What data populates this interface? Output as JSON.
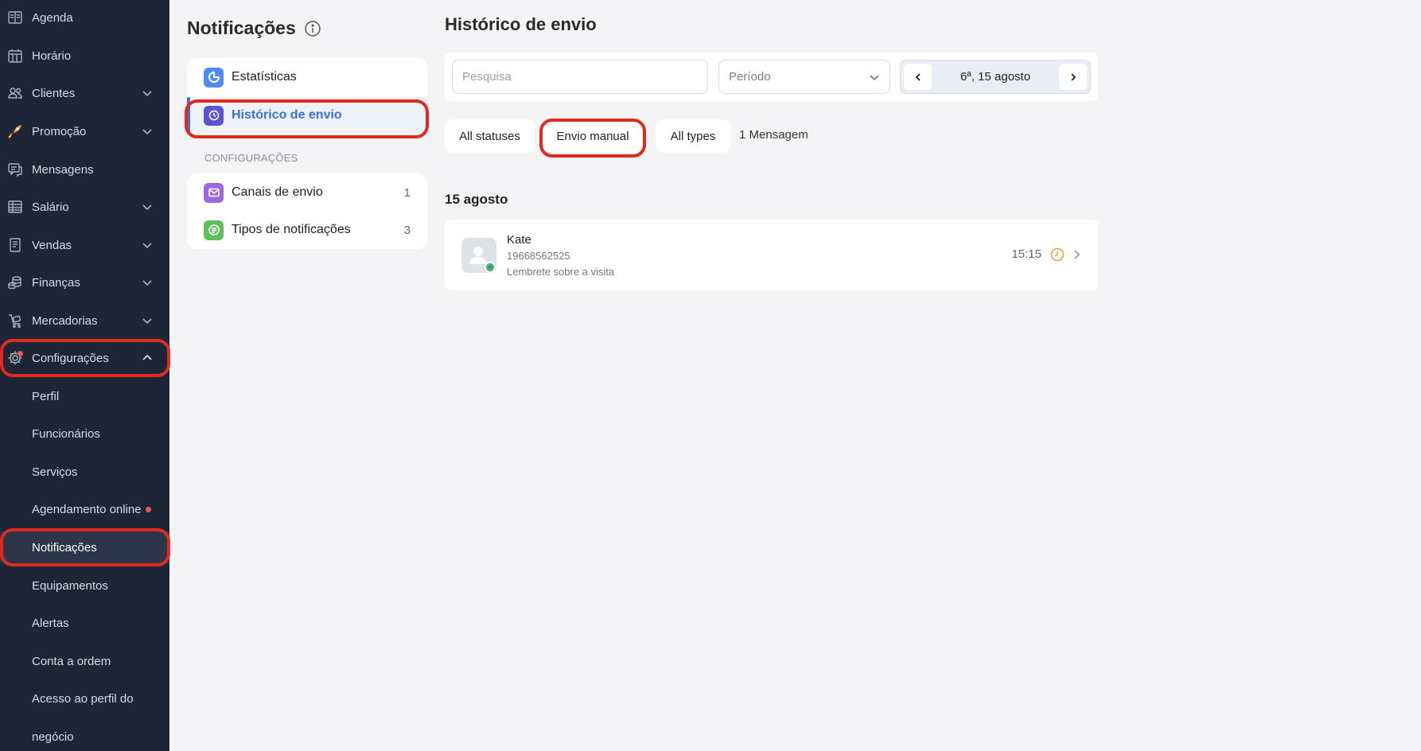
{
  "colors": {
    "sidebar_bg": "#1c2636",
    "highlight": "#e02a1f",
    "accent_blue": "#3a6fd8",
    "badge_dot": "#e85a4f",
    "clock_orange": "#f0a030"
  },
  "sidebar": {
    "items": [
      {
        "label": "Agenda",
        "icon": "calendar-book-icon"
      },
      {
        "label": "Horário",
        "icon": "calendar-grid-icon"
      },
      {
        "label": "Clientes",
        "icon": "users-icon"
      },
      {
        "label": "Promoção",
        "icon": "rocket-icon"
      },
      {
        "label": "Mensagens",
        "icon": "chat-icon"
      },
      {
        "label": "Salário",
        "icon": "table-icon"
      },
      {
        "label": "Vendas",
        "icon": "receipt-icon"
      },
      {
        "label": "Finanças",
        "icon": "coins-icon"
      },
      {
        "label": "Mercadorias",
        "icon": "cart-icon"
      },
      {
        "label": "Configurações",
        "icon": "gear-icon"
      }
    ],
    "subitems": [
      {
        "label": "Perfil"
      },
      {
        "label": "Funcionários"
      },
      {
        "label": "Serviços"
      },
      {
        "label": "Agendamento online"
      },
      {
        "label": "Notificações"
      },
      {
        "label": "Equipamentos"
      },
      {
        "label": "Alertas"
      },
      {
        "label": "Conta a ordem"
      },
      {
        "label": "Acesso ao perfil do"
      },
      {
        "label": "negócio"
      }
    ]
  },
  "notifications_panel": {
    "title": "Notificações",
    "menu": [
      {
        "label": "Estatísticas",
        "icon": "statistics-icon"
      },
      {
        "label": "Histórico de envio",
        "icon": "history-icon"
      }
    ],
    "section_label": "CONFIGURAÇÕES",
    "settings": [
      {
        "label": "Canais de envio",
        "count": "1",
        "icon": "envelope-icon"
      },
      {
        "label": "Tipos de notificações",
        "count": "3",
        "icon": "list-icon"
      }
    ]
  },
  "main": {
    "title": "Histórico de envio",
    "search_placeholder": "Pesquisa",
    "period_placeholder": "Período",
    "date_label": "6ª, 15 agosto",
    "chips": [
      "All statuses",
      "Envio manual",
      "All types"
    ],
    "message_count": "1 Mensagem",
    "date_header": "15 agosto",
    "row": {
      "name": "Kate",
      "phone": "19668562525",
      "description": "Lembrete sobre a visita",
      "time": "15:15"
    }
  }
}
